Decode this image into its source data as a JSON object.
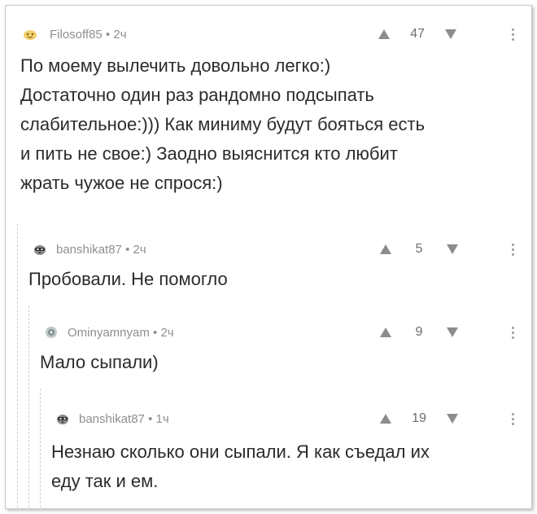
{
  "comments": [
    {
      "author": "Filosoff85",
      "time": "2ч",
      "rating": "47",
      "avatar_icon": "emoji-avatar-icon",
      "text": "По моему вылечить довольно легко:)\nДостаточно один раз рандомно подсыпать\nслабительное:))) Как миниму будут бояться есть\nи пить не свое:) Заодно выяснится кто любит\nжрать чужое не спрося:)"
    },
    {
      "author": "banshikat87",
      "time": "2ч",
      "rating": "5",
      "avatar_icon": "raccoon-avatar-icon",
      "text": "Пробовали. Не помогло"
    },
    {
      "author": "Ominyamnyam",
      "time": "2ч",
      "rating": "9",
      "avatar_icon": "round-avatar-icon",
      "text": "Мало сыпали)"
    },
    {
      "author": "banshikat87",
      "time": "1ч",
      "rating": "19",
      "avatar_icon": "raccoon-avatar-icon",
      "text": "Незнаю сколько они сыпали. Я как съедал их\nеду так и ем."
    }
  ],
  "separator": " • ",
  "colors": {
    "meta": "#8f8f8f",
    "text": "#2b2b2b",
    "arrow": "#8c8c8c",
    "thread_line": "#cfcfcf"
  }
}
